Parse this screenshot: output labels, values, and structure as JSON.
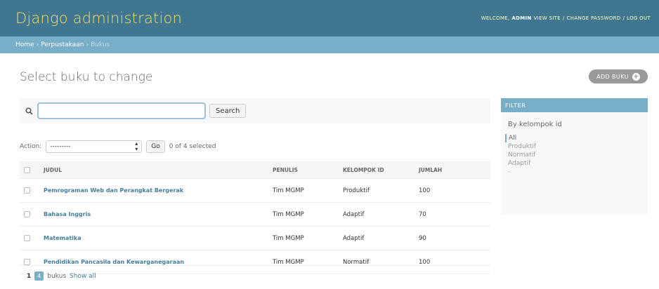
{
  "header": {
    "branding": "Django administration",
    "welcome": "WELCOME,",
    "username": "ADMIN",
    "view_site": "VIEW SITE",
    "change_password": "CHANGE PASSWORD",
    "log_out": "LOG OUT",
    "separator": "/"
  },
  "breadcrumbs": {
    "home": "Home",
    "app": "Perpustakaan",
    "model": "Bukus",
    "separator": "›"
  },
  "page_title": "Select buku to change",
  "add_button": "ADD BUKU",
  "search": {
    "value": "",
    "button": "Search"
  },
  "actions": {
    "label": "Action:",
    "selected_option": "---------",
    "go_button": "Go",
    "counter": "0 of 4 selected"
  },
  "table": {
    "columns": [
      "JUDUL",
      "PENULIS",
      "KELOMPOK ID",
      "JUMLAH"
    ],
    "rows": [
      {
        "judul": "Pemrograman Web dan Perangkat Bergerak",
        "penulis": "Tim MGMP",
        "kelompok": "Produktif",
        "jumlah": "100"
      },
      {
        "judul": "Bahasa Inggris",
        "penulis": "Tim MGMP",
        "kelompok": "Adaptif",
        "jumlah": "70"
      },
      {
        "judul": "Matematika",
        "penulis": "Tim MGMP",
        "kelompok": "Adaptif",
        "jumlah": "90"
      },
      {
        "judul": "Pendidikan Pancasila dan Kewarganegaraan",
        "penulis": "Tim MGMP",
        "kelompok": "Normatif",
        "jumlah": "100"
      }
    ]
  },
  "paginator": {
    "page": "1",
    "current": "4",
    "count_label": "bukus",
    "show_all": "Show all"
  },
  "filter": {
    "header": "FILTER",
    "title": "By kelompok id",
    "options": [
      "All",
      "Produktif",
      "Normatif",
      "Adaptif",
      "-"
    ]
  }
}
